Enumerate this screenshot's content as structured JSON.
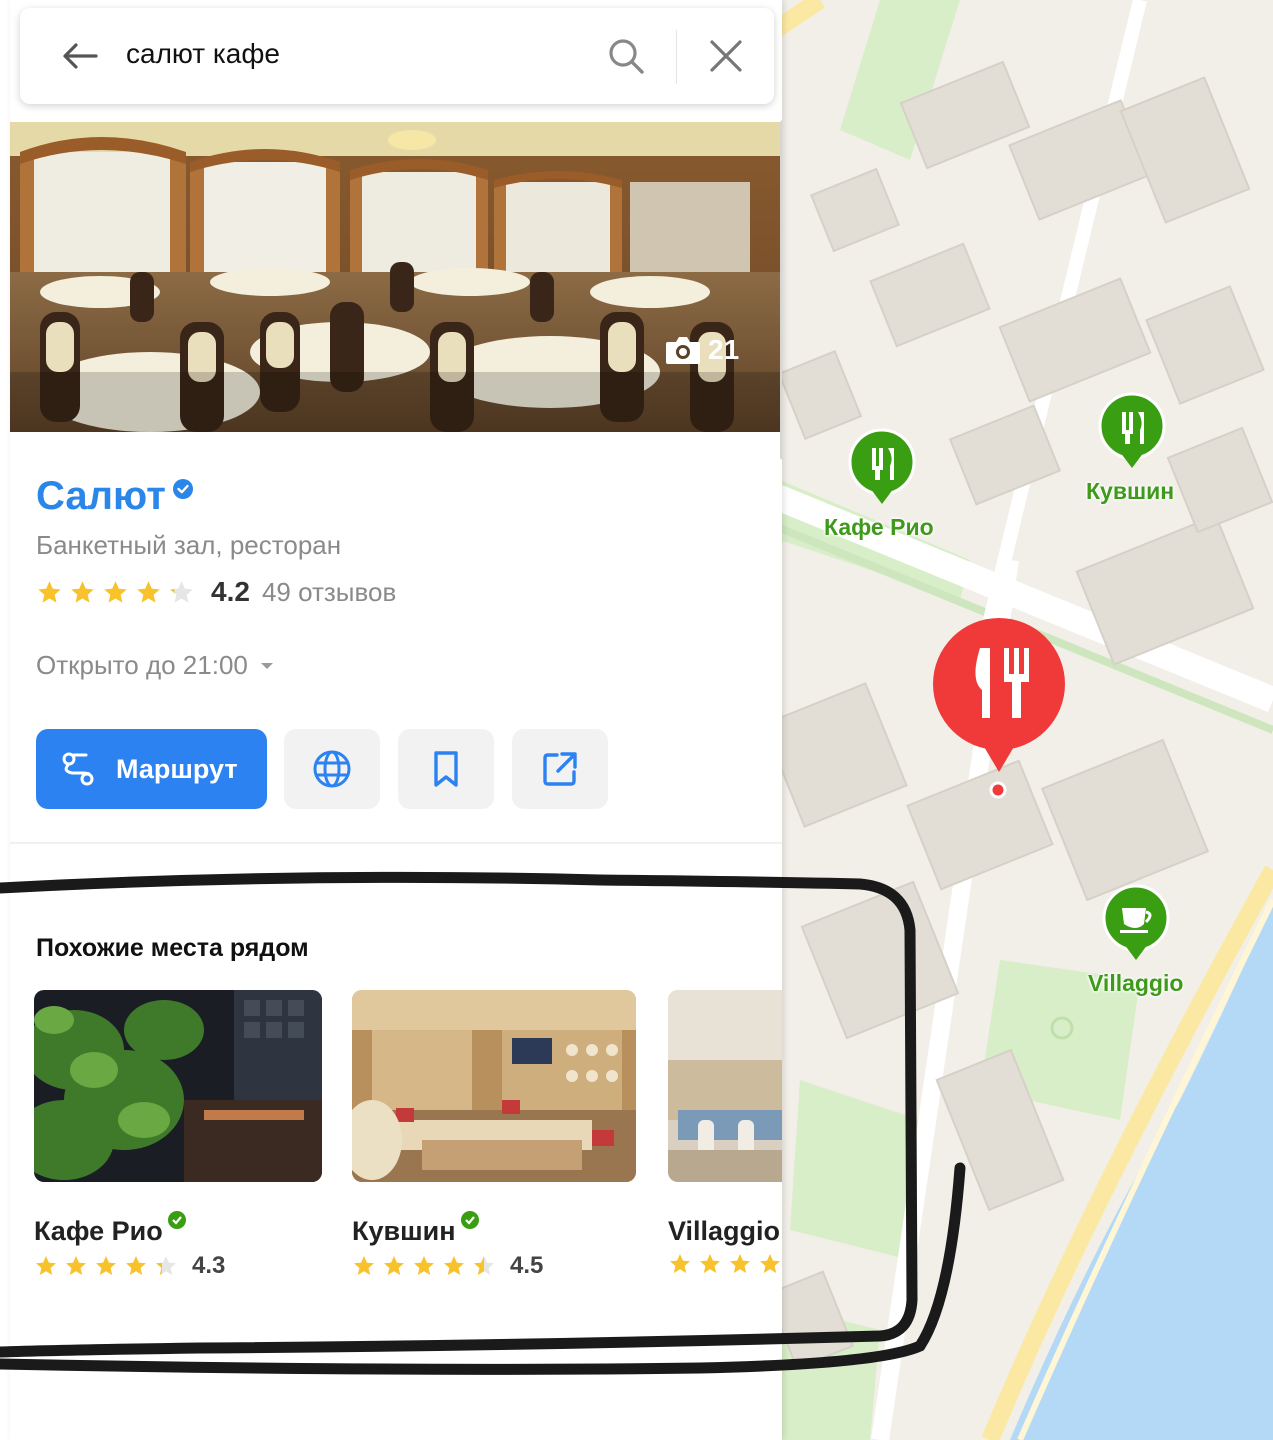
{
  "search": {
    "query": "салют кафе"
  },
  "hero": {
    "photo_count": "21"
  },
  "place": {
    "title": "Салют",
    "category": "Банкетный зал, ресторан",
    "rating": "4.2",
    "rating_stars": 4.2,
    "reviews": "49 отзывов",
    "hours": "Открыто до 21:00"
  },
  "actions": {
    "route_label": "Маршрут"
  },
  "similar": {
    "title": "Похожие места рядом",
    "items": [
      {
        "name": "Кафе Рио",
        "rating": "4.3",
        "rating_stars": 4.3
      },
      {
        "name": "Кувшин",
        "rating": "4.5",
        "rating_stars": 4.5
      },
      {
        "name": "Villaggio",
        "rating": "",
        "rating_stars": 4.0
      }
    ]
  },
  "map": {
    "labels": {
      "cafe_rio": "Кафе Рио",
      "kuvshin": "Кувшин",
      "villaggio": "Villaggio"
    }
  },
  "colors": {
    "accent": "#2c82f0",
    "title_link": "#2a86e8",
    "pin_red": "#f03a3a",
    "pin_green": "#3a9e12",
    "star": "#f8c22c",
    "water": "#b4d9f7",
    "park": "#d8eec8"
  }
}
